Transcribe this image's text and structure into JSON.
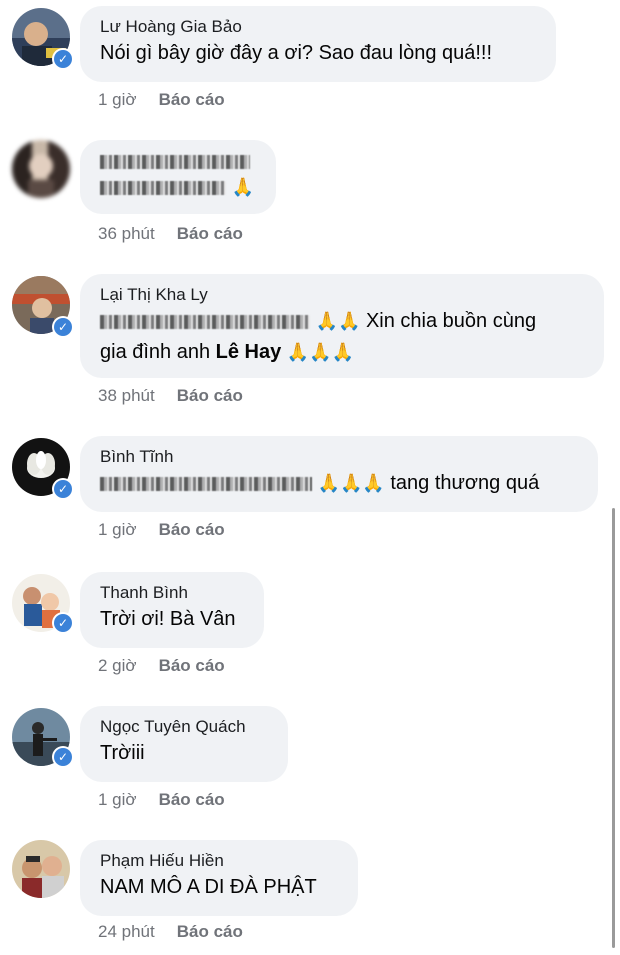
{
  "comments": [
    {
      "name": "Lư Hoàng Gia Bảo",
      "text": "Nói gì bây giờ đây a ơi? Sao đau lòng quá!!!",
      "time": "1 giờ",
      "report": "Báo cáo",
      "verified": true
    },
    {
      "name": "",
      "text": "",
      "time": "36 phút",
      "report": "Báo cáo",
      "verified": false,
      "emoji": "🙏"
    },
    {
      "name": "Lại Thị Kha Ly",
      "text_line1_suffix": "Xin chia buồn cùng",
      "text_line2_prefix": "gia đình anh ",
      "text_line2_bold": "Lê Hay",
      "emoji_a": "🙏🙏",
      "emoji_b": "🙏🙏🙏",
      "time": "38 phút",
      "report": "Báo cáo",
      "verified": true
    },
    {
      "name": "Bình Tĩnh",
      "text_suffix": "tang thương quá",
      "emoji": "🙏🙏🙏",
      "time": "1 giờ",
      "report": "Báo cáo",
      "verified": true
    },
    {
      "name": "Thanh Bình",
      "text": "Trời ơi! Bà Vân",
      "time": "2 giờ",
      "report": "Báo cáo",
      "verified": true
    },
    {
      "name": "Ngọc Tuyên Quách",
      "text": "Trờiii",
      "time": "1 giờ",
      "report": "Báo cáo",
      "verified": true
    },
    {
      "name": "Phạm Hiếu Hiền",
      "text": "NAM MÔ A DI ĐÀ PHẬT",
      "time": "24 phút",
      "report": "Báo cáo",
      "verified": false
    }
  ],
  "icons": {
    "verified": "verified-badge-icon",
    "pray": "folded-hands-emoji"
  },
  "colors": {
    "bubble": "#f0f2f5",
    "meta": "#707379",
    "verified": "#3b82d8",
    "pray": "#e8a63a"
  }
}
